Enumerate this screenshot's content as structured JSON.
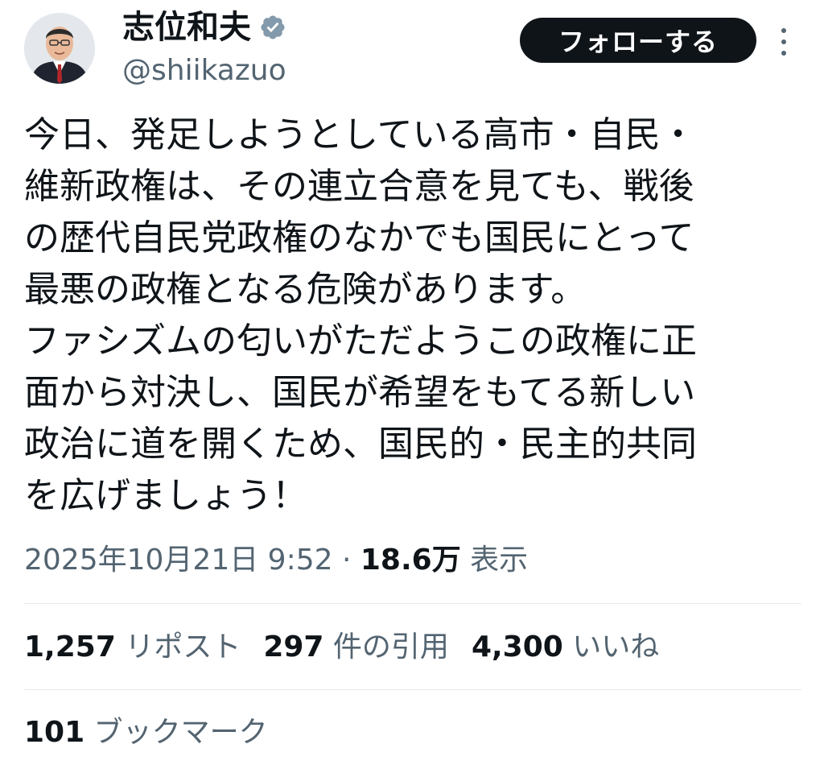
{
  "user": {
    "display_name": "志位和夫",
    "handle": "@shiikazuo",
    "verified_icon": "verified-badge-icon",
    "avatar": "profile-photo"
  },
  "actions": {
    "follow_label": "フォローする",
    "more_icon": "more-vertical-icon"
  },
  "tweet": {
    "lines": [
      "今日、発足しようとしている高市・自民・",
      "維新政権は、その連立合意を見ても、戦後",
      "の歴代自民党政権のなかでも国民にとって",
      "最悪の政権となる危険があります。",
      "ファシズムの匂いがただようこの政権に正",
      "面から対決し、国民が希望をもてる新しい",
      "政治に道を開くため、国民的・民主的共同",
      "を広げましょう！"
    ],
    "timestamp": "2025年10月21日 9:52",
    "separator": " · ",
    "views_count": "18.6万",
    "views_label": " 表示"
  },
  "stats": {
    "reposts_count": "1,257",
    "reposts_label": " リポスト",
    "quotes_count": "297",
    "quotes_label": " 件の引用",
    "likes_count": "4,300",
    "likes_label": " いいね",
    "bookmarks_count": "101",
    "bookmarks_label": " ブックマーク"
  },
  "colors": {
    "text_primary": "#0f1419",
    "text_secondary": "#536471",
    "button_bg": "#0f1419",
    "verified": "#829aab",
    "divider": "#e5e8eb"
  }
}
